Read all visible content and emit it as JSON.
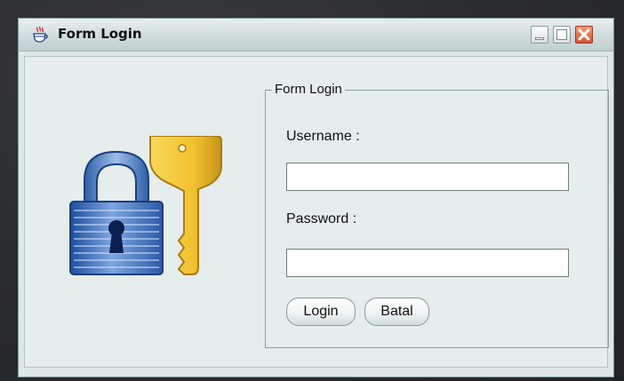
{
  "window": {
    "title": "Form Login",
    "app_icon": "java-coffee-cup-icon",
    "controls": [
      "minimize",
      "maximize",
      "close"
    ]
  },
  "illustration": {
    "icon": "lock-and-key-icon"
  },
  "form": {
    "legend": "Form Login",
    "username_label": "Username :",
    "username_value": "",
    "password_label": "Password :",
    "password_value": "",
    "login_label": "Login",
    "cancel_label": "Batal"
  },
  "colors": {
    "close_button": "#d9532c",
    "lock_blue": "#2f5fb0",
    "key_gold": "#f2c230"
  }
}
